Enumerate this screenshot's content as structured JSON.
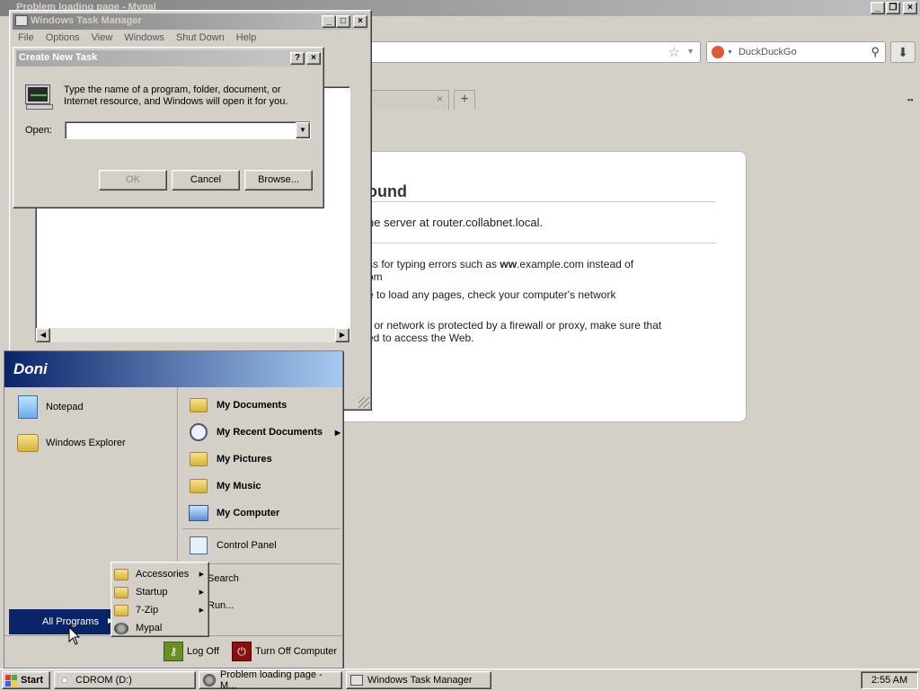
{
  "browser": {
    "window_title": "Problem loading page - Mypal",
    "search_engine": "DuckDuckGo",
    "error": {
      "title_fragment": "ound",
      "server_msg_fragment": "he server at router.collabnet.local.",
      "tip1_line1": "ss for typing errors such as ",
      "tip1_bold": "ww",
      "tip1_rest": ".example.com instead of",
      "tip1_line2": "om",
      "tip2": "e to load any pages, check your computer's network",
      "tip3_line1": "r or network is protected by a firewall or proxy, make sure that",
      "tip3_line2": "ed to access the Web."
    }
  },
  "task_manager": {
    "title": "Windows Task Manager",
    "menu": [
      "File",
      "Options",
      "View",
      "Windows",
      "Shut Down",
      "Help"
    ]
  },
  "run_dialog": {
    "title": "Create New Task",
    "description": "Type the name of a program, folder, document, or Internet resource, and Windows will open it for you.",
    "open_label": "Open:",
    "open_value": "",
    "ok": "OK",
    "cancel": "Cancel",
    "browse": "Browse..."
  },
  "start_menu": {
    "user": "Doni",
    "left_items": [
      "Notepad",
      "Windows Explorer"
    ],
    "right_items": [
      {
        "label": "My Documents",
        "arrow": false
      },
      {
        "label": "My Recent Documents",
        "arrow": true
      },
      {
        "label": "My Pictures",
        "arrow": false
      },
      {
        "label": "My Music",
        "arrow": false
      },
      {
        "label": "My Computer",
        "arrow": false
      }
    ],
    "control_panel": "Control Panel",
    "search": "Search",
    "run": "Run...",
    "all_programs": "All Programs",
    "log_off": "Log Off",
    "turn_off": "Turn Off Computer"
  },
  "programs_submenu": [
    {
      "label": "Accessories",
      "arrow": true
    },
    {
      "label": "Startup",
      "arrow": true
    },
    {
      "label": "7-Zip",
      "arrow": true
    },
    {
      "label": "Mypal",
      "arrow": false
    }
  ],
  "taskbar": {
    "start": "Start",
    "tasks": [
      "CDROM (D:)",
      "Problem loading page - M...",
      "Windows Task Manager"
    ],
    "clock": "2:55 AM"
  },
  "colors": {
    "start_header": "#0a246a",
    "taskbar": "#d4d0c8",
    "selected": "#0a246a"
  }
}
